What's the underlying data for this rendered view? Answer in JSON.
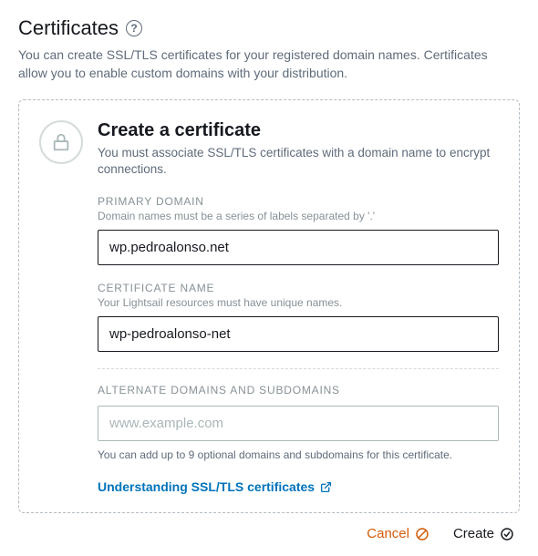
{
  "header": {
    "title": "Certificates",
    "description": "You can create SSL/TLS certificates for your registered domain names. Certificates allow you to enable custom domains with your distribution."
  },
  "card": {
    "title": "Create a certificate",
    "subtitle": "You must associate SSL/TLS certificates with a domain name to encrypt connections."
  },
  "primary": {
    "label": "PRIMARY DOMAIN",
    "hint": "Domain names must be a series of labels separated by '.'",
    "value": "wp.pedroalonso.net"
  },
  "certName": {
    "label": "CERTIFICATE NAME",
    "hint": "Your Lightsail resources must have unique names.",
    "value": "wp-pedroalonso-net"
  },
  "alternate": {
    "label": "ALTERNATE DOMAINS AND SUBDOMAINS",
    "placeholder": "www.example.com",
    "bottomHint": "You can add up to 9 optional domains and subdomains for this certificate."
  },
  "link": {
    "text": "Understanding SSL/TLS certificates"
  },
  "actions": {
    "cancel": "Cancel",
    "create": "Create"
  }
}
